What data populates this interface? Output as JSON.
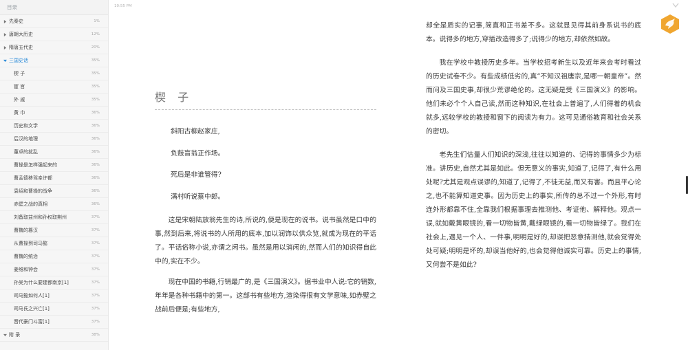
{
  "sidebar": {
    "title": "目录",
    "items": [
      {
        "label": "先秦史",
        "pct": "1%",
        "level": 0,
        "caret": "collapsed"
      },
      {
        "label": "唐朝大历史",
        "pct": "12%",
        "level": 0,
        "caret": "collapsed"
      },
      {
        "label": "隋唐五代史",
        "pct": "20%",
        "level": 0,
        "caret": "collapsed"
      },
      {
        "label": "三国史话",
        "pct": "35%",
        "level": 0,
        "caret": "expanded",
        "active": true
      },
      {
        "label": "楔 子",
        "pct": "35%",
        "level": 1
      },
      {
        "label": "宦 官",
        "pct": "35%",
        "level": 1
      },
      {
        "label": "外 戚",
        "pct": "35%",
        "level": 1
      },
      {
        "label": "黄 巾",
        "pct": "36%",
        "level": 1
      },
      {
        "label": "历史和文学",
        "pct": "36%",
        "level": 1
      },
      {
        "label": "后汉的地理",
        "pct": "36%",
        "level": 1
      },
      {
        "label": "董卓的扰乱",
        "pct": "36%",
        "level": 1
      },
      {
        "label": "曹操是怎样强起来的",
        "pct": "36%",
        "level": 1
      },
      {
        "label": "曹孟德移驾幸许都",
        "pct": "36%",
        "level": 1
      },
      {
        "label": "袁绍和曹操的战争",
        "pct": "36%",
        "level": 1
      },
      {
        "label": "赤壁之战的真相",
        "pct": "36%",
        "level": 1
      },
      {
        "label": "刘备取益州和孙权取荆州",
        "pct": "37%",
        "level": 1
      },
      {
        "label": "曹魏的篡汉",
        "pct": "37%",
        "level": 1
      },
      {
        "label": "从曹操到司马懿",
        "pct": "37%",
        "level": 1
      },
      {
        "label": "曹魏的统治",
        "pct": "37%",
        "level": 1
      },
      {
        "label": "姜维和钟会",
        "pct": "37%",
        "level": 1
      },
      {
        "label": "孙吴为什么要建都南京[1]",
        "pct": "37%",
        "level": 1
      },
      {
        "label": "司马懿如何人[1]",
        "pct": "37%",
        "level": 1
      },
      {
        "label": "司马氏之兴亡[1]",
        "pct": "37%",
        "level": 1
      },
      {
        "label": "晋代豪门斗富[1]",
        "pct": "37%",
        "level": 1
      },
      {
        "label": "附 录",
        "pct": "38%",
        "level": 0,
        "caret": "expanded"
      }
    ]
  },
  "reader": {
    "time": "10:55 PM",
    "chapter_title": "楔 子",
    "poem": [
      "斜阳古柳赵家庄,",
      "负鼓盲翁正作场。",
      "死后是非谁管得?",
      "满村听说蔡中郎。"
    ],
    "left_paragraphs": [
      "这是宋朝陆放翁先生的诗,所说的,便是现在的说书。说书虽然是口中的事,然到后来,将说书的人所用的底本,加以润饰以供众览,就成为现在的平话了。平话俗称小说,亦谓之闲书。虽然是用以消闲的,然而人们的知识得自此中的,实在不少。",
      "现在中国的书籍,行销最广的,是《三国演义》。据书业中人说:它的销数,年年是各种书籍中的第一。这部书有些地方,渲染得很有文学意味,如赤壁之战前后便是;有些地方,"
    ],
    "right_paragraphs": [
      "却全是质实的记事,简直和正书差不多。这就显见得其前身系说书的底本。说得多的地方,穿插改造得多了;说得少的地方,却依然如故。",
      "我在学校中教授历史多年。当学校招考新生以及近年来会考时看过的历史试卷不少。有些成绩低劣的,真“不知汉祖唐宗,是哪一朝皇帝”。然而问及三国史事,却很少荒谬绝伦的。这无疑是受《三国演义》的影响。他们未必个个人自己读,然而这种知识,在社会上普遍了,人们得着的机会就多,远较学校的教授和窗下的阅读为有力。这可见通俗教育和社会关系的密切。",
      "老先生们估量人们知识的深浅,往往以知道的、记得的事情多少为标准。讲历史,自然尤其是如此。但无意义的事实,知道了,记得了,有什么用处呢?尤其是观点误谬的,知道了,记得了,不徒无益,而又有害。而且平心论之,也不能算知道史事。因为历史上的事实,所传的总不过一个外形,有时连外形都靠不住,全靠我们根据事理去推测他、考证他、解释他。观点一误,就如戴黄眼镜的,看一切物皆黄,戴绿眼镜的,看一切物皆绿了。我们在社会上,遇见一个人、一件事,明明是好的,却误把恶意猜测他,就会觉得处处可疑;明明是坏的,却误当他好的,也会觉得他诚实可靠。历史上的事情,又何尝不是如此?"
    ]
  },
  "colors": {
    "accent": "#2b8bd8",
    "badge": "#f0a630"
  },
  "icons": {
    "caret_collapsed": "caret-right-icon",
    "caret_expanded": "caret-down-icon",
    "badge": "bird-book-icon",
    "bookmark": "chevron-down-icon"
  }
}
